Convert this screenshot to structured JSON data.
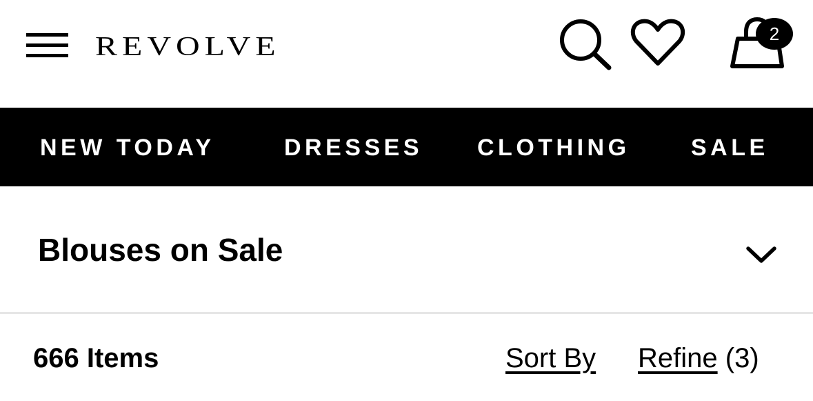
{
  "header": {
    "logo": "REVOLVE",
    "icons": {
      "menu": "hamburger-menu-icon",
      "search": "search-icon",
      "wishlist": "heart-icon",
      "bag": "shopping-bag-icon"
    },
    "bag_count": "2"
  },
  "nav": {
    "items": [
      {
        "label": "NEW TODAY"
      },
      {
        "label": "DRESSES"
      },
      {
        "label": "CLOTHING"
      },
      {
        "label": "SALE"
      }
    ]
  },
  "category": {
    "title": "Blouses on Sale",
    "toggle_icon": "chevron-down-icon"
  },
  "results": {
    "count_label": "666 Items",
    "sort_label": "Sort By",
    "refine_label": "Refine",
    "refine_count": "(3)"
  },
  "colors": {
    "primary": "#000000",
    "background": "#ffffff",
    "divider": "#e6e6e6"
  }
}
